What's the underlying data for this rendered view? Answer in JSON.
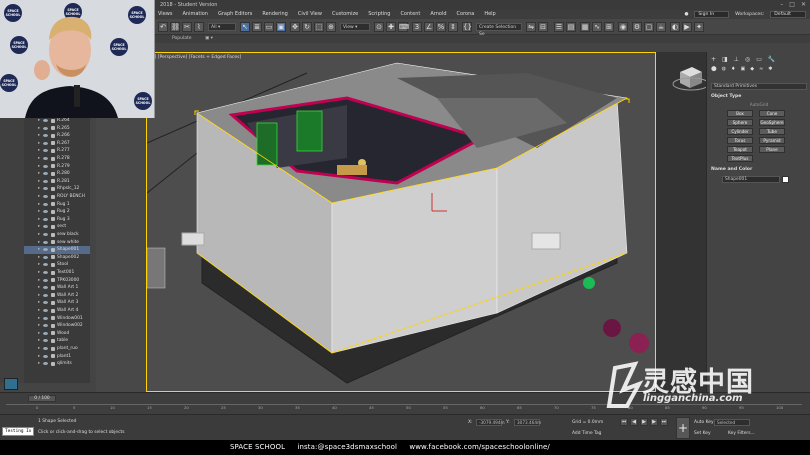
{
  "window": {
    "title": "2018 - Student Version",
    "controls": [
      "–",
      "□",
      "✕"
    ]
  },
  "menu": [
    "Views",
    "Animation",
    "Graph Editors",
    "Rendering",
    "Civil View",
    "Customize",
    "Scripting",
    "Content",
    "Arnold",
    "Corona",
    "Help"
  ],
  "account": {
    "signin": "Sign In",
    "workspaces_label": "Workspaces:",
    "workspace": "Default"
  },
  "toolbar": {
    "view_dropdown": "View",
    "selection_set": "Create Selection Se"
  },
  "ribbon": {
    "label": "Populate"
  },
  "viewport": {
    "label": "[+] [Perspective] [Facets + Edged Faces]"
  },
  "explorer": {
    "rows": [
      {
        "label": "R.264"
      },
      {
        "label": "R.265"
      },
      {
        "label": "R.266"
      },
      {
        "label": "R.267"
      },
      {
        "label": "R.277"
      },
      {
        "label": "R.278"
      },
      {
        "label": "R.279"
      },
      {
        "label": "R.280"
      },
      {
        "label": "R.281"
      },
      {
        "label": "Rhpslc_12"
      },
      {
        "label": "ROLY BENCH"
      },
      {
        "label": "Rug 1"
      },
      {
        "label": "Rug 2"
      },
      {
        "label": "Rug 3"
      },
      {
        "label": "sect"
      },
      {
        "label": "sew black"
      },
      {
        "label": "sew white"
      },
      {
        "label": "Shape001"
      },
      {
        "label": "Shape002"
      },
      {
        "label": "Stool"
      },
      {
        "label": "Text001"
      },
      {
        "label": "TPK03000"
      },
      {
        "label": "Wall Art 1"
      },
      {
        "label": "Wall Art 2"
      },
      {
        "label": "Wall Art 3"
      },
      {
        "label": "Wall Art 4"
      },
      {
        "label": "Window001"
      },
      {
        "label": "Window002"
      },
      {
        "label": "Wood"
      },
      {
        "label": "table"
      },
      {
        "label": "plant_ruo"
      },
      {
        "label": "plant1"
      },
      {
        "label": "qlimits"
      }
    ]
  },
  "command_panel": {
    "dropdown": "Standard Primitives",
    "object_type_title": "Object Type",
    "autogrid": "AutoGrid",
    "buttons": [
      "Box",
      "Cone",
      "Sphere",
      "GeoSphere",
      "Cylinder",
      "Tube",
      "Torus",
      "Pyramid",
      "Teapot",
      "Plane",
      "TextPlus"
    ],
    "name_color_title": "Name and Color",
    "object_name": "Shape001"
  },
  "timeline": {
    "frame": "0 / 100",
    "ticks": [
      "0",
      "5",
      "10",
      "15",
      "20",
      "25",
      "30",
      "35",
      "40",
      "45",
      "50",
      "55",
      "60",
      "65",
      "70",
      "75",
      "80",
      "85",
      "90",
      "95",
      "100"
    ]
  },
  "status": {
    "selected": "1 Shape Selected",
    "hint": "Click or click-and-drag to select objects",
    "testing": "Testing Ix",
    "x_label": "X:",
    "x_value": "-3079.494m",
    "y_label": "Y:",
    "y_value": "3073.464m",
    "grid": "Grid = 0.0mm",
    "add_time_tag": "Add Time Tag",
    "auto_key": "Auto Key",
    "set_key": "Set Key",
    "selected_mode": "Selected",
    "key_filters": "Key Filters..."
  },
  "footer": {
    "brand": "SPACE SCHOOL",
    "insta": "insta:@space3dsmaxschool",
    "facebook": "www.facebook.com/spaceschoolonline/"
  },
  "webcam": {
    "badges": [
      "SPACE SCHOOL",
      "SPACE SCHOOL",
      "SPACE SCHOOL",
      "SPACE SCHOOL",
      "SPACE SCHOOL",
      "SPACE SCHOOL",
      "SPACE SCHOOL"
    ]
  },
  "watermark": {
    "chinese": "灵感中国",
    "url": "lingganchina.com"
  }
}
